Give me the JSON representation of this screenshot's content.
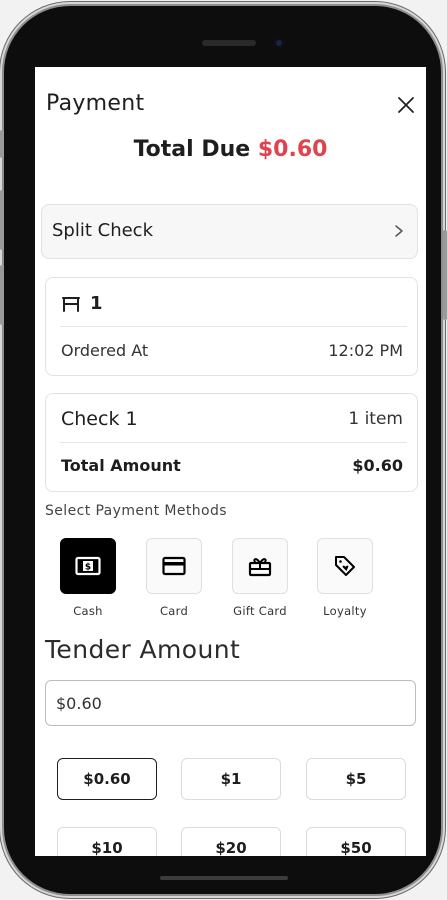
{
  "header": {
    "title": "Payment",
    "close_icon": "close-icon"
  },
  "total_due": {
    "label": "Total Due",
    "amount": "$0.60"
  },
  "split_check": {
    "label": "Split Check",
    "icon": "chevron-right-icon"
  },
  "table_info": {
    "icon": "table-icon",
    "table_number": "1",
    "ordered_label": "Ordered At",
    "ordered_time": "12:02 PM"
  },
  "check": {
    "title": "Check 1",
    "items": "1 item",
    "total_label": "Total Amount",
    "total_value": "$0.60"
  },
  "payment_methods": {
    "section_label": "Select Payment Methods",
    "options": [
      {
        "label": "Cash",
        "icon": "cash-icon",
        "selected": true
      },
      {
        "label": "Card",
        "icon": "card-icon",
        "selected": false
      },
      {
        "label": "Gift Card",
        "icon": "gift-card-icon",
        "selected": false
      },
      {
        "label": "Loyalty",
        "icon": "loyalty-tag-icon",
        "selected": false
      }
    ]
  },
  "tender": {
    "title": "Tender Amount",
    "value": "$0.60",
    "quick_amounts": [
      "$0.60",
      "$1",
      "$5",
      "$10",
      "$20",
      "$50"
    ],
    "selected_index": 0
  },
  "colors": {
    "accent": "#e0434e",
    "text": "#1e1e1e",
    "selected_method_bg": "#000000"
  }
}
